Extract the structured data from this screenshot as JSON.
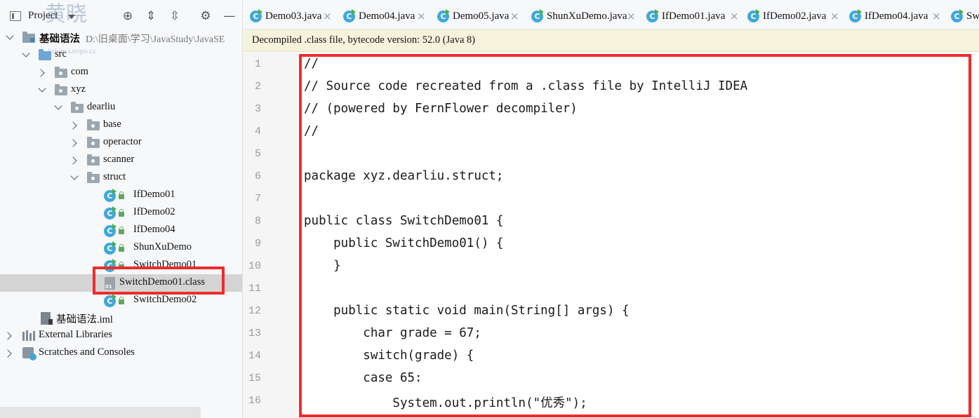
{
  "project_panel": {
    "title": "Project",
    "header_buttons": [
      {
        "name": "locate-icon",
        "glyph": "⊕"
      },
      {
        "name": "expand-all-icon",
        "glyph": "⇕"
      },
      {
        "name": "collapse-all-icon",
        "glyph": "⇳"
      },
      {
        "name": "gear-icon",
        "glyph": "⚙"
      },
      {
        "name": "hide-icon",
        "glyph": "—"
      }
    ],
    "tree": {
      "root_label": "基础语法",
      "root_path": "D:\\旧桌面\\学习\\JavaStudy\\JavaSE",
      "src": "src",
      "com": "com",
      "xyz": "xyz",
      "dearliu": "dearliu",
      "base": "base",
      "operactor": "operactor",
      "scanner": "scanner",
      "struct": "struct",
      "classes": [
        "IfDemo01",
        "IfDemo02",
        "IfDemo04",
        "ShunXuDemo",
        "SwitchDemo01"
      ],
      "selected_class_file": "SwitchDemo01.class",
      "last_class": "SwitchDemo02",
      "iml": "基础语法.iml",
      "external_libraries": "External Libraries",
      "scratches": "Scratches and Consoles"
    }
  },
  "tabs": [
    {
      "label": "Demo03.java"
    },
    {
      "label": "Demo04.java"
    },
    {
      "label": "Demo05.java"
    },
    {
      "label": "ShunXuDemo.java"
    },
    {
      "label": "IfDemo01.java"
    },
    {
      "label": "IfDemo02.java"
    },
    {
      "label": "IfDemo04.java"
    },
    {
      "label": "Sw"
    }
  ],
  "banner": "Decompiled .class file, bytecode version: 52.0 (Java 8)",
  "code": {
    "line_numbers": [
      "1",
      "2",
      "3",
      "4",
      "5",
      "6",
      "7",
      "8",
      "9",
      "10",
      "11",
      "12",
      "13",
      "14",
      "15",
      "16"
    ],
    "lines": [
      "//",
      "// Source code recreated from a .class file by IntelliJ IDEA",
      "// (powered by FernFlower decompiler)",
      "//",
      "",
      "package xyz.dearliu.struct;",
      "",
      "public class SwitchDemo01 {",
      "    public SwitchDemo01() {",
      "    }",
      "",
      "    public static void main(String[] args) {",
      "        char grade = 67;",
      "        switch(grade) {",
      "        case 65:",
      "            System.out.println(\"优秀\");"
    ]
  },
  "colors": {
    "highlight_red": "#ee2c2c",
    "banner_bg": "#f6f3dc",
    "selection_bg": "#d4d4d4",
    "java_icon": "#40a8d9"
  }
}
